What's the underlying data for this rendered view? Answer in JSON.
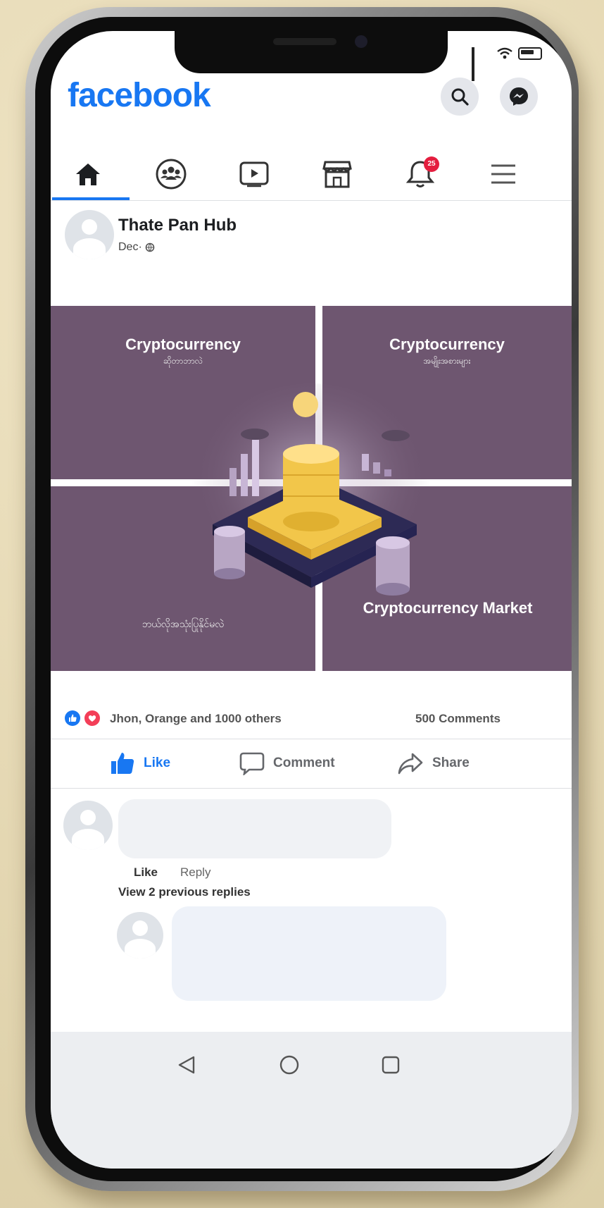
{
  "app": {
    "logo": "facebook"
  },
  "header": {
    "icons": [
      "search-icon",
      "messenger-icon"
    ]
  },
  "nav": {
    "items": [
      {
        "icon": "home-icon",
        "active": true
      },
      {
        "icon": "groups-icon"
      },
      {
        "icon": "watch-icon"
      },
      {
        "icon": "marketplace-icon"
      },
      {
        "icon": "notifications-icon",
        "badge": "25"
      },
      {
        "icon": "menu-icon"
      }
    ]
  },
  "post": {
    "page_name": "Thate Pan Hub",
    "date": "Dec·",
    "image": {
      "panels": [
        {
          "title": "Cryptocurrency",
          "subtitle": "ဆိုတာဘာလဲ"
        },
        {
          "title": "Cryptocurrency",
          "subtitle": "အမျိုးအစားများ"
        },
        {
          "title": "",
          "subtitle": "ဘယ်လိုအသုံးပြုနိုင်မလဲ"
        },
        {
          "title": "Cryptocurrency Market",
          "subtitle": ""
        }
      ],
      "colors": {
        "panel": "#6e5670",
        "coin": "#f2c64a"
      }
    },
    "reactions": {
      "summary": "Jhon, Orange and 1000 others",
      "comments": "500 Comments",
      "icons": [
        "like-reaction-icon",
        "love-reaction-icon"
      ]
    },
    "actions": {
      "like": "Like",
      "comment": "Comment",
      "share": "Share"
    },
    "comment_links": {
      "like": "Like",
      "reply": "Reply",
      "view_replies": "View 2 previous replies"
    }
  },
  "system_nav": {
    "icons": [
      "back-icon",
      "home-circle-icon",
      "recents-icon"
    ]
  },
  "colors": {
    "brand": "#1877f2",
    "badge": "#e41e3f",
    "background": "#e8dcb8"
  }
}
